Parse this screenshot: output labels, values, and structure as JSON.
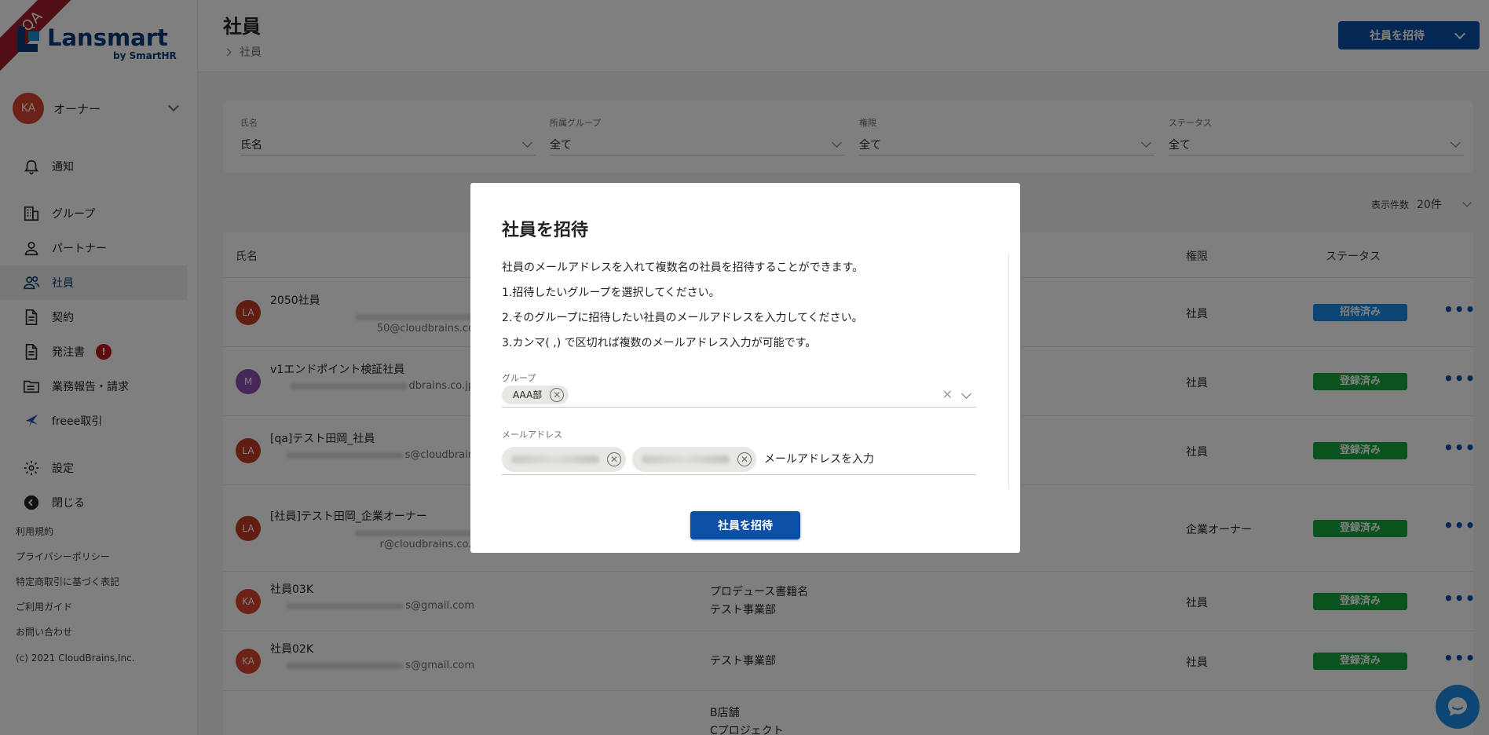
{
  "app": {
    "ribbon": "QA",
    "logo": "Lansmart",
    "logo_sub": "by SmartHR",
    "brand_color": "#0b4fa6"
  },
  "account": {
    "initials": "KA",
    "name": "オーナー"
  },
  "sidebar": {
    "items": [
      {
        "label": "通知",
        "icon": "bell-icon"
      },
      {
        "label": "グループ",
        "icon": "building-icon"
      },
      {
        "label": "パートナー",
        "icon": "person-icon"
      },
      {
        "label": "社員",
        "icon": "people-icon",
        "active": true
      },
      {
        "label": "契約",
        "icon": "document-icon"
      },
      {
        "label": "発注書",
        "icon": "document-icon",
        "badge": "!"
      },
      {
        "label": "業務報告・請求",
        "icon": "folder-icon"
      },
      {
        "label": "freee取引",
        "icon": "freee-icon"
      },
      {
        "label": "設定",
        "icon": "gear-icon"
      },
      {
        "label": "閉じる",
        "icon": "collapse-icon"
      }
    ],
    "footer_links": [
      "利用規約",
      "プライバシーポリシー",
      "特定商取引に基づく表記",
      "ご利用ガイド",
      "お問い合わせ"
    ],
    "copyright": "(c) 2021 CloudBrains,Inc."
  },
  "header": {
    "title": "社員",
    "breadcrumb": "社員",
    "invite_button": "社員を招待"
  },
  "filters": [
    {
      "label": "氏名",
      "value": "氏名"
    },
    {
      "label": "所属グループ",
      "value": "全て"
    },
    {
      "label": "権限",
      "value": "全て"
    },
    {
      "label": "ステータス",
      "value": "全て"
    }
  ],
  "pagination": {
    "label": "表示件数",
    "value": "20件"
  },
  "table": {
    "headers": {
      "name": "氏名",
      "role": "権限",
      "status": "ステータス"
    },
    "rows": [
      {
        "initials": "LA",
        "color": "#c53a27",
        "name": "2050社員",
        "email": "50@cloudbrains.co",
        "groups": "",
        "role": "社員",
        "status": "招待済み",
        "status_color": "#1a8ce6"
      },
      {
        "initials": "M",
        "color": "#8a4fb5",
        "name": "v1エンドポイント検証社員",
        "email": "dbrains.co.jp",
        "groups": "",
        "role": "社員",
        "status": "登録済み",
        "status_color": "#14a53c"
      },
      {
        "initials": "LA",
        "color": "#c53a27",
        "name": "[qa]テスト田岡_社員",
        "email": "s@cloudbrain",
        "groups": "",
        "role": "社員",
        "status": "登録済み",
        "status_color": "#14a53c"
      },
      {
        "initials": "LA",
        "color": "#c53a27",
        "name": "[社員]テスト田岡_企業オーナー",
        "email": "r@cloudbrains.co.j",
        "groups": "",
        "role": "企業オーナー",
        "status": "登録済み",
        "status_color": "#14a53c"
      },
      {
        "initials": "KA",
        "color": "#d9452c",
        "name": "社員03K",
        "email": "s@gmail.com",
        "groups": "プロデュース書籍名\nテスト事業部",
        "role": "社員",
        "status": "登録済み",
        "status_color": "#14a53c"
      },
      {
        "initials": "KA",
        "color": "#d9452c",
        "name": "社員02K",
        "email": "s@gmail.com",
        "groups": "テスト事業部",
        "role": "社員",
        "status": "登録済み",
        "status_color": "#14a53c"
      },
      {
        "initials": "",
        "color": "",
        "name": "",
        "email": "",
        "groups": "B店舗\nCプロジェクト",
        "role": "",
        "status": "",
        "status_color": ""
      }
    ]
  },
  "modal": {
    "title": "社員を招待",
    "description": [
      "社員のメールアドレスを入れて複数名の社員を招待することができます。",
      "1.招待したいグループを選択してください。",
      "2.そのグループに招待したい社員のメールアドレスを入力してください。",
      "3.カンマ( ,) で区切れば複数のメールアドレス入力が可能です。"
    ],
    "group_label": "グループ",
    "group_chip": "AAA部",
    "email_label": "メールアドレス",
    "email_placeholder": "メールアドレスを入力",
    "submit": "社員を招待"
  }
}
